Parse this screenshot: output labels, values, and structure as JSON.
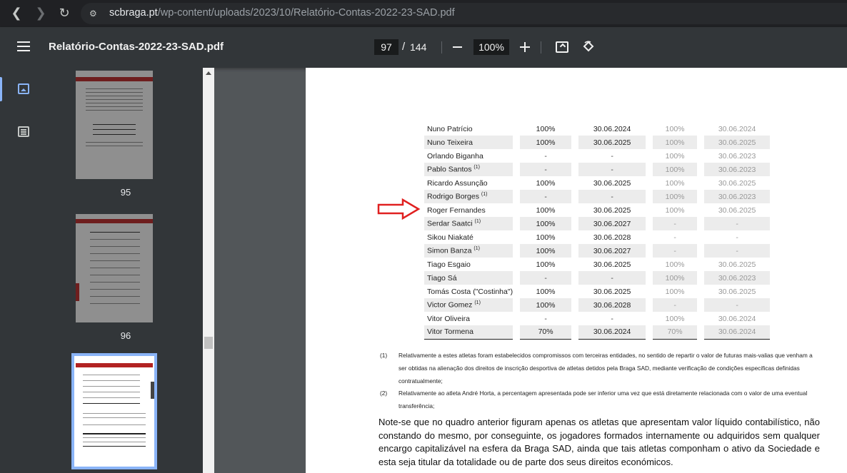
{
  "browser": {
    "url_host": "scbraga.pt",
    "url_path": "/wp-content/uploads/2023/10/Relatório-Contas-2022-23-SAD.pdf"
  },
  "toolbar": {
    "title": "Relatório-Contas-2022-23-SAD.pdf",
    "page_current": "97",
    "page_separator": "/",
    "page_total": "144",
    "zoom": "100%"
  },
  "thumbnails": [
    {
      "label": "95"
    },
    {
      "label": "96"
    }
  ],
  "table": {
    "rows": [
      {
        "name": "Nuno Patrício",
        "sup": "",
        "pct": "100%",
        "date": "30.06.2024",
        "pct2": "100%",
        "date2": "30.06.2024"
      },
      {
        "name": "Nuno Teixeira",
        "sup": "",
        "pct": "100%",
        "date": "30.06.2025",
        "pct2": "100%",
        "date2": "30.06.2025"
      },
      {
        "name": "Orlando Biganha",
        "sup": "",
        "pct": "-",
        "date": "-",
        "pct2": "100%",
        "date2": "30.06.2023"
      },
      {
        "name": "Pablo Santos",
        "sup": "(1)",
        "pct": "-",
        "date": "-",
        "pct2": "100%",
        "date2": "30.06.2023"
      },
      {
        "name": "Ricardo Assunção",
        "sup": "",
        "pct": "100%",
        "date": "30.06.2025",
        "pct2": "100%",
        "date2": "30.06.2025"
      },
      {
        "name": "Rodrigo Borges",
        "sup": "(1)",
        "pct": "-",
        "date": "-",
        "pct2": "100%",
        "date2": "30.06.2023"
      },
      {
        "name": "Roger Fernandes",
        "sup": "",
        "pct": "100%",
        "date": "30.06.2025",
        "pct2": "100%",
        "date2": "30.06.2025"
      },
      {
        "name": "Serdar Saatci",
        "sup": "(1)",
        "pct": "100%",
        "date": "30.06.2027",
        "pct2": "-",
        "date2": "-"
      },
      {
        "name": "Sikou Niakaté",
        "sup": "",
        "pct": "100%",
        "date": "30.06.2028",
        "pct2": "-",
        "date2": "-"
      },
      {
        "name": "Simon Banza",
        "sup": "(1)",
        "pct": "100%",
        "date": "30.06.2027",
        "pct2": "-",
        "date2": "-"
      },
      {
        "name": "Tiago Esgaio",
        "sup": "",
        "pct": "100%",
        "date": "30.06.2025",
        "pct2": "100%",
        "date2": "30.06.2025"
      },
      {
        "name": "Tiago Sá",
        "sup": "",
        "pct": "-",
        "date": "-",
        "pct2": "100%",
        "date2": "30.06.2023"
      },
      {
        "name": "Tomás Costa (\"Costinha\")",
        "sup": "",
        "pct": "100%",
        "date": "30.06.2025",
        "pct2": "100%",
        "date2": "30.06.2025"
      },
      {
        "name": "Victor Gomez",
        "sup": "(1)",
        "pct": "100%",
        "date": "30.06.2028",
        "pct2": "-",
        "date2": "-"
      },
      {
        "name": "Vitor Oliveira",
        "sup": "",
        "pct": "-",
        "date": "-",
        "pct2": "100%",
        "date2": "30.06.2024"
      },
      {
        "name": "Vitor Tormena",
        "sup": "",
        "pct": "70%",
        "date": "30.06.2024",
        "pct2": "70%",
        "date2": "30.06.2024"
      }
    ]
  },
  "notes": [
    {
      "num": "(1)",
      "text": "Relativamente a estes atletas foram estabelecidos compromissos com terceiras entidades, no sentido de repartir o valor de futuras mais-valias que venham a ser obtidas na alienação dos direitos de inscrição desportiva de atletas detidos pela Braga SAD, mediante verificação de condições especificas definidas contratualmente;"
    },
    {
      "num": "(2)",
      "text": "Relativamente ao atleta André Horta, a percentagem apresentada pode ser inferior uma vez que está diretamente relacionada com o valor de uma eventual transferência;"
    }
  ],
  "body_text": "Note-se que no quadro anterior figuram apenas os atletas que apresentam valor líquido contabilístico, não constando do mesmo, por conseguinte, os jogadores formados internamente ou adquiridos sem qualquer encargo capitalizável na esfera da Braga SAD, ainda que tais atletas componham o ativo da Sociedade e esta seja titular da totalidade ou de parte dos seus direitos económicos.",
  "colors": {
    "accent": "#8ab4f8",
    "arrow": "#e02020",
    "toolbar_bg": "#323639",
    "viewer_bg": "#525659"
  }
}
